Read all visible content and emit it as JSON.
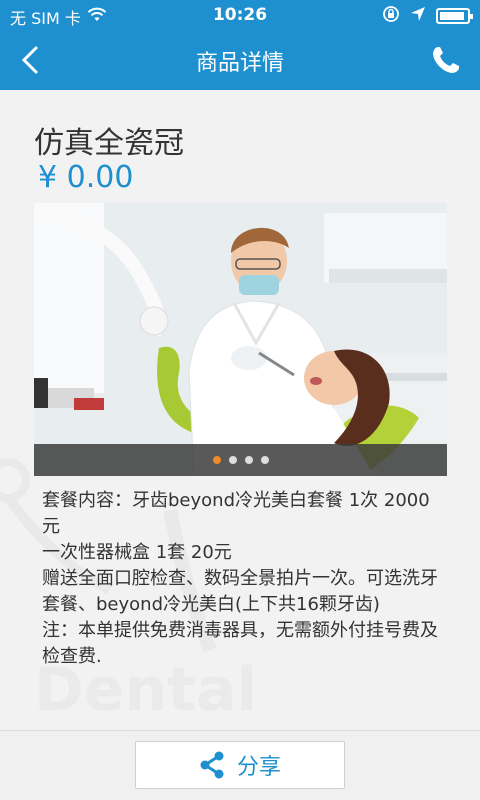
{
  "status_bar": {
    "carrier": "无 SIM 卡",
    "time": "10:26"
  },
  "nav": {
    "title": "商品详情"
  },
  "product": {
    "name": "仿真全瓷冠",
    "price": "¥ 0.00"
  },
  "banner": {
    "slide_count": 4,
    "active_index": 0
  },
  "description": [
    "套餐内容：牙齿beyond冷光美白套餐 1次 2000元",
    "一次性器械盒 1套 20元",
    "赠送全面口腔检查、数码全景拍片一次。可选洗牙套餐、beyond冷光美白(上下共16颗牙齿)",
    "注：本单提供免费消毒器具，无需额外付挂号费及检查费."
  ],
  "footer": {
    "share_label": "分享"
  },
  "colors": {
    "primary": "#1e90d0",
    "accent_dot": "#f08a2a",
    "text": "#333333"
  }
}
